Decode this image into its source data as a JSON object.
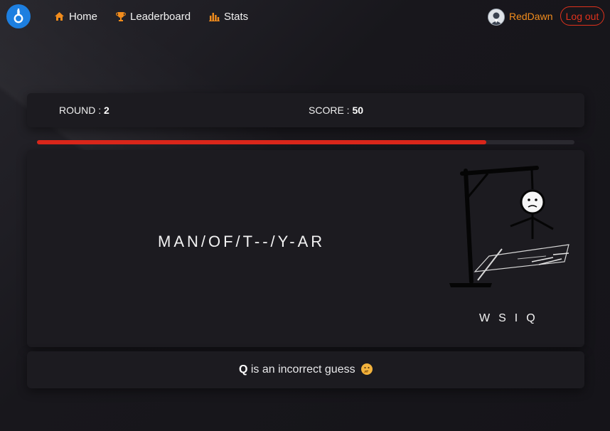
{
  "nav": {
    "home_label": "Home",
    "leaderboard_label": "Leaderboard",
    "stats_label": "Stats",
    "username": "RedDawn",
    "logout_label": "Log out"
  },
  "game": {
    "round_label": "ROUND :",
    "round_value": "2",
    "score_label": "SCORE :",
    "score_value": "50",
    "progress_fraction": 0.836,
    "word_display": "MAN/OF/T--/Y-AR",
    "guessed_letters": "WSIQ",
    "message_letter": "Q",
    "message_text": "is an incorrect guess"
  },
  "colors": {
    "accent_orange": "#f28c1c",
    "danger_red": "#e0321c",
    "progress_red": "#d9261a",
    "logo_blue": "#1d7fe0"
  },
  "icons": {
    "logo": "noose-icon",
    "home": "home-icon",
    "leaderboard": "trophy-icon",
    "stats": "bar-chart-icon",
    "message_emoji": "thinking-face-emoji"
  }
}
